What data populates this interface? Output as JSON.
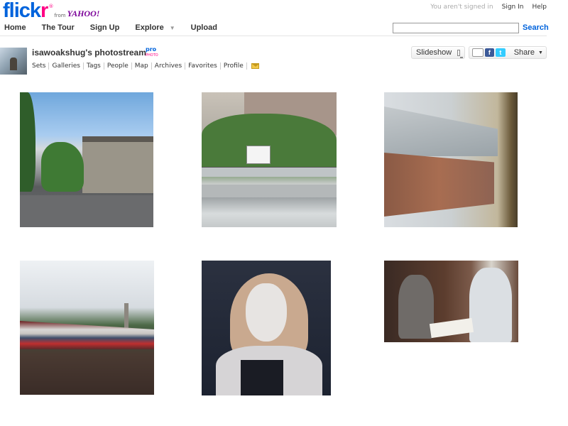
{
  "brand": {
    "logo_blue": "flick",
    "logo_pink": "r",
    "registered": "®",
    "from": "from",
    "yahoo": "YAHOO!",
    "colors": {
      "blue": "#0063dc",
      "pink": "#ff0084"
    }
  },
  "account": {
    "status": "You aren't signed in",
    "sign_in": "Sign In",
    "help": "Help"
  },
  "nav": {
    "home": "Home",
    "tour": "The Tour",
    "signup": "Sign Up",
    "explore": "Explore",
    "upload": "Upload"
  },
  "search": {
    "value": "",
    "button": "Search"
  },
  "stream": {
    "title": "isawoakshug's photostream",
    "badge": "pro",
    "badge_sub": "PHOTO",
    "subnav": [
      "Sets",
      "Galleries",
      "Tags",
      "People",
      "Map",
      "Archives",
      "Favorites",
      "Profile"
    ]
  },
  "actions": {
    "slideshow": "Slideshow",
    "share": "Share"
  },
  "photos": [
    {
      "subject": "street-houses"
    },
    {
      "subject": "railway-platform"
    },
    {
      "subject": "train-window-station"
    },
    {
      "subject": "passing-train-blur"
    },
    {
      "subject": "painted-portrait-woman"
    },
    {
      "subject": "painted-two-men"
    }
  ]
}
